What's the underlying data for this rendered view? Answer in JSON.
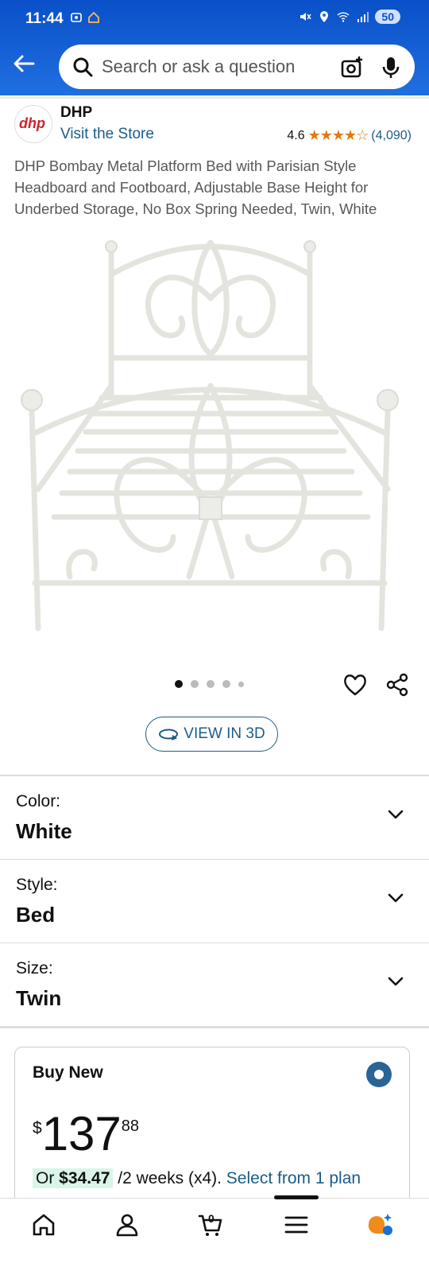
{
  "status_bar": {
    "time": "11:44",
    "battery": "50"
  },
  "search": {
    "placeholder": "Search or ask a question"
  },
  "brand": {
    "logo_text": "dhp",
    "name": "DHP",
    "store_link": "Visit the Store"
  },
  "rating": {
    "value": "4.6",
    "stars": "★★★★☆",
    "count": "(4,090)"
  },
  "product": {
    "title": "DHP Bombay Metal Platform Bed with Parisian Style Headboard and Footboard, Adjustable Base Height for Underbed Storage, No Box Spring Needed, Twin, White"
  },
  "carousel": {
    "total": 5,
    "active_index": 0
  },
  "view3d": {
    "label": "VIEW IN 3D"
  },
  "variations": [
    {
      "label": "Color:",
      "value": "White"
    },
    {
      "label": "Style:",
      "value": "Bed"
    },
    {
      "label": "Size:",
      "value": "Twin"
    }
  ],
  "buy": {
    "title": "Buy New",
    "currency": "$",
    "price_whole": "137",
    "price_fraction": "88",
    "plan_prefix": "Or ",
    "plan_amount": "$34.47",
    "plan_terms": " /2 weeks (x4). ",
    "plan_link": "Select from 1 plan"
  },
  "bottom_nav": {
    "items": [
      "home-icon",
      "account-icon",
      "cart-icon",
      "menu-icon",
      "rufus-icon"
    ],
    "cart_count": "0"
  },
  "colors": {
    "header_blue": "#0a50c8",
    "link_blue": "#1a5c8a",
    "star_orange": "#e47911"
  }
}
